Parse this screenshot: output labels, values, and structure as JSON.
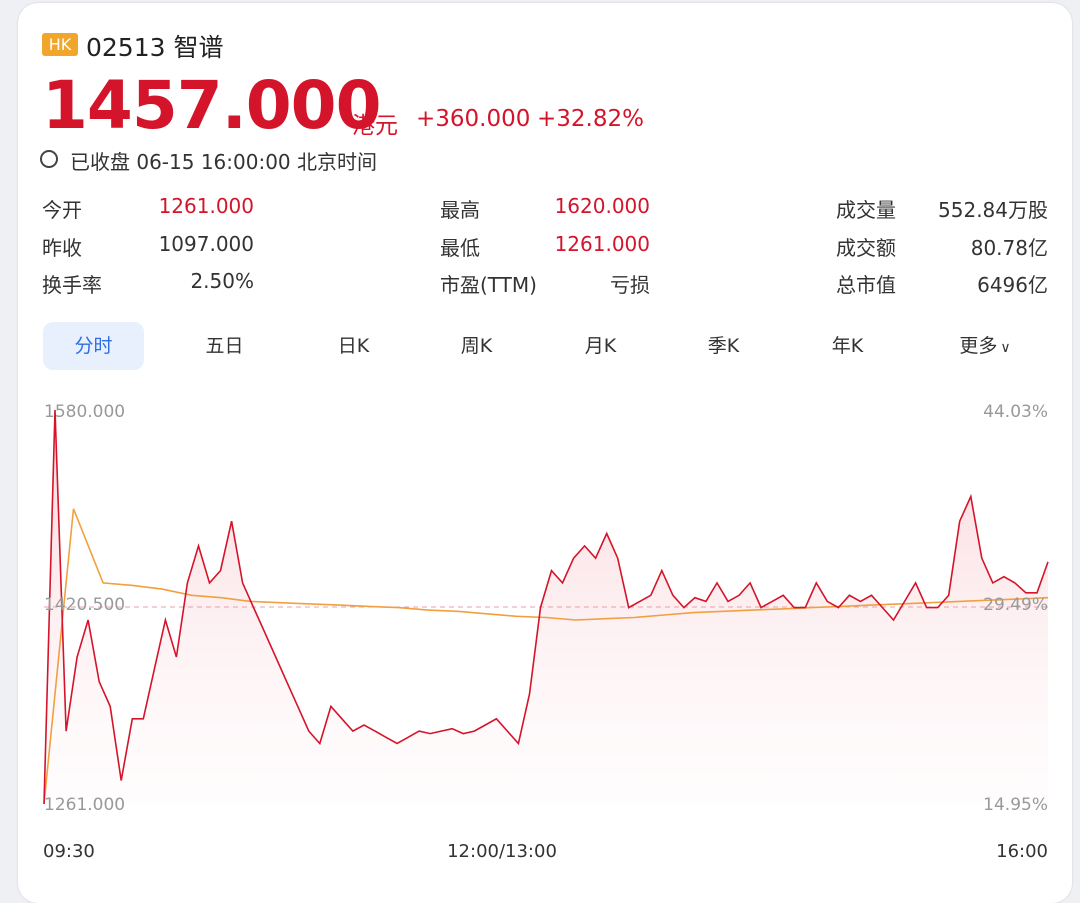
{
  "stock": {
    "market_badge": "HK",
    "name": "02513 智谱",
    "price": "1457.000",
    "currency": "港元",
    "change": "+360.000",
    "change_pct": "+32.82%",
    "status": "已收盘 06-15 16:00:00 北京时间"
  },
  "stats": [
    {
      "label": "今开",
      "value": "1261.000",
      "color": "red"
    },
    {
      "label": "最高",
      "value": "1620.000",
      "color": "red"
    },
    {
      "label": "成交量",
      "value": "552.84万股",
      "color": "normal"
    },
    {
      "label": "昨收",
      "value": "1097.000",
      "color": "normal"
    },
    {
      "label": "最低",
      "value": "1261.000",
      "color": "red"
    },
    {
      "label": "成交额",
      "value": "80.78亿",
      "color": "normal"
    },
    {
      "label": "换手率",
      "value": "2.50%",
      "color": "normal"
    },
    {
      "label": "市盈(TTM)",
      "value": "亏损",
      "color": "normal"
    },
    {
      "label": "总市值",
      "value": "6496亿",
      "color": "normal"
    }
  ],
  "tabs": [
    "分时",
    "五日",
    "日K",
    "周K",
    "月K",
    "季K",
    "年K",
    "更多"
  ],
  "active_tab": 0,
  "chart": {
    "price_labels": [
      "1580.000",
      "1420.500",
      "1261.000"
    ],
    "pct_labels": [
      "44.03%",
      "29.49%",
      "14.95%"
    ],
    "time_labels": [
      "09:30",
      "12:00/13:00",
      "16:00"
    ]
  },
  "colors": {
    "up": "#d4142a",
    "avg_line": "#f0a040",
    "accent": "#2f6fe4",
    "badge": "#f0a62b"
  },
  "chart_data": {
    "type": "line",
    "ylim": [
      1261.0,
      1580.0
    ],
    "prev_close_ref": 1420.5,
    "x": [
      "09:30",
      "12:00/13:00",
      "16:00"
    ],
    "series": [
      {
        "values": [
          1261,
          1580,
          1320,
          1380,
          1410,
          1360,
          1340,
          1280,
          1330,
          1330,
          1370,
          1410,
          1380,
          1440,
          1470,
          1440,
          1450,
          1490,
          1440,
          1420,
          1400,
          1380,
          1360,
          1340,
          1320,
          1310,
          1340,
          1330,
          1320,
          1325,
          1320,
          1315,
          1310,
          1315,
          1320,
          1318,
          1320,
          1322,
          1318,
          1320,
          1325,
          1330,
          1320,
          1310,
          1350,
          1420,
          1450,
          1440,
          1460,
          1470,
          1460,
          1480,
          1460,
          1420,
          1425,
          1430,
          1450,
          1430,
          1420,
          1428,
          1425,
          1440,
          1425,
          1430,
          1440,
          1420,
          1425,
          1430,
          1420,
          1420,
          1440,
          1425,
          1420,
          1430,
          1425,
          1430,
          1420,
          1410,
          1425,
          1440,
          1420,
          1420,
          1430,
          1490,
          1510,
          1460,
          1440,
          1445,
          1440,
          1432,
          1432,
          1457
        ]
      },
      {
        "values": [
          1261,
          1500,
          1440,
          1438,
          1435,
          1430,
          1428,
          1425,
          1424,
          1423,
          1422,
          1421,
          1420,
          1418,
          1417,
          1415,
          1413,
          1412,
          1410,
          1411,
          1412,
          1414,
          1416,
          1417,
          1418,
          1419,
          1420,
          1421,
          1422,
          1423,
          1424,
          1425,
          1426,
          1427,
          1428
        ]
      }
    ]
  }
}
